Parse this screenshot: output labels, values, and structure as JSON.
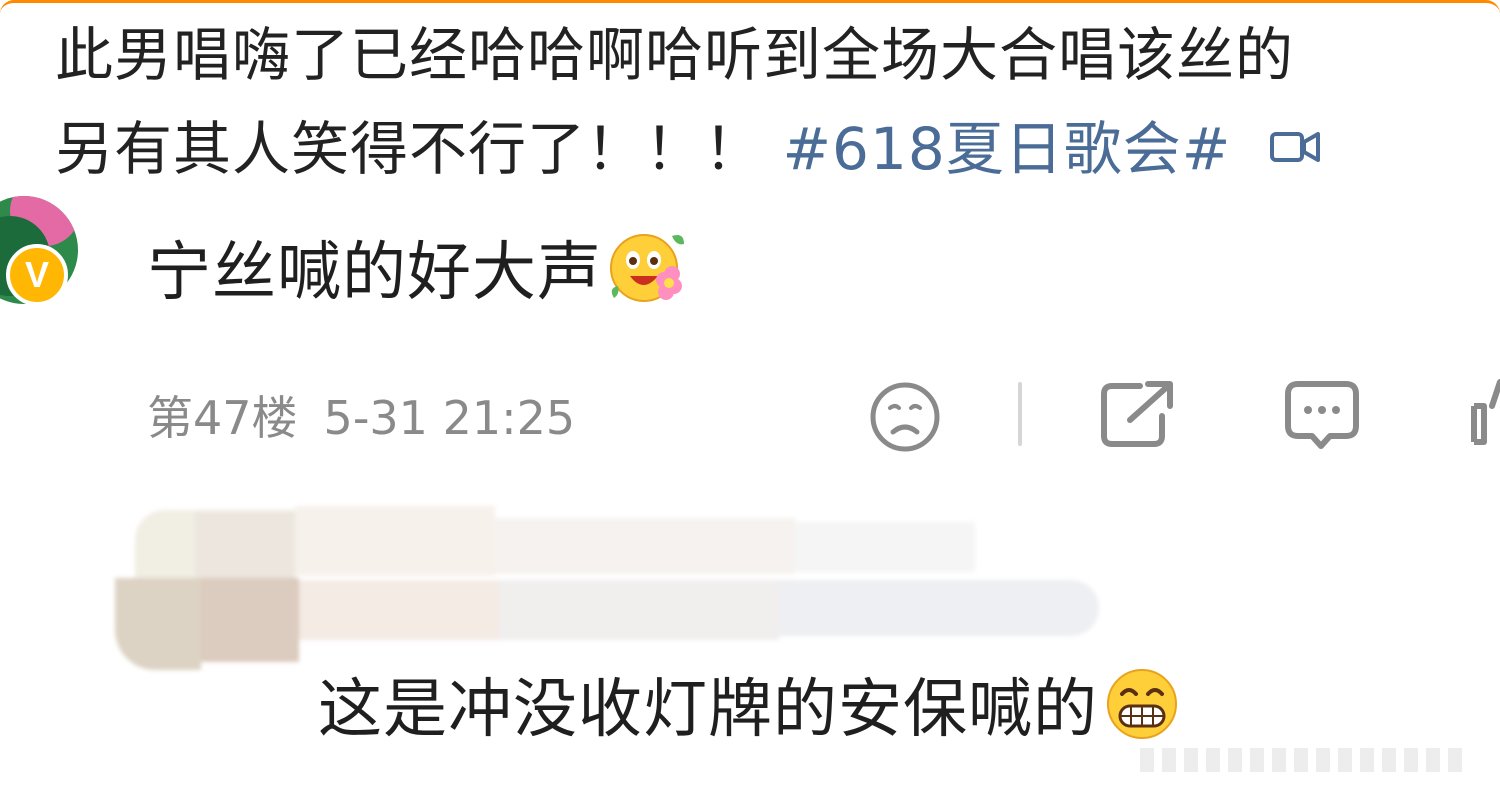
{
  "post": {
    "text_line1": "此男唱嗨了已经哈哈啊哈听到全场大合唱该丝的",
    "text_line2": "另有其人笑得不行了！！！",
    "topic": "#618夏日歌会#",
    "video_icon": "video-camera-icon"
  },
  "comment": {
    "avatar_badge": "V",
    "text": "宁丝喊的好大声",
    "emoji": "happy-flower-emoji",
    "floor": "第47楼",
    "time": "5-31 21:25"
  },
  "actions": {
    "dislike_icon": "sad-face-icon",
    "share_icon": "share-icon",
    "comment_icon": "comment-bubble-icon",
    "like_icon": "thumbs-up-icon"
  },
  "reply": {
    "text": "这是冲没收灯牌的安保喊的",
    "emoji": "grin-emoji"
  },
  "colors": {
    "accent_border": "#ff8a00",
    "topic_link": "#4a6c96",
    "meta_gray": "#8a8a8a"
  }
}
